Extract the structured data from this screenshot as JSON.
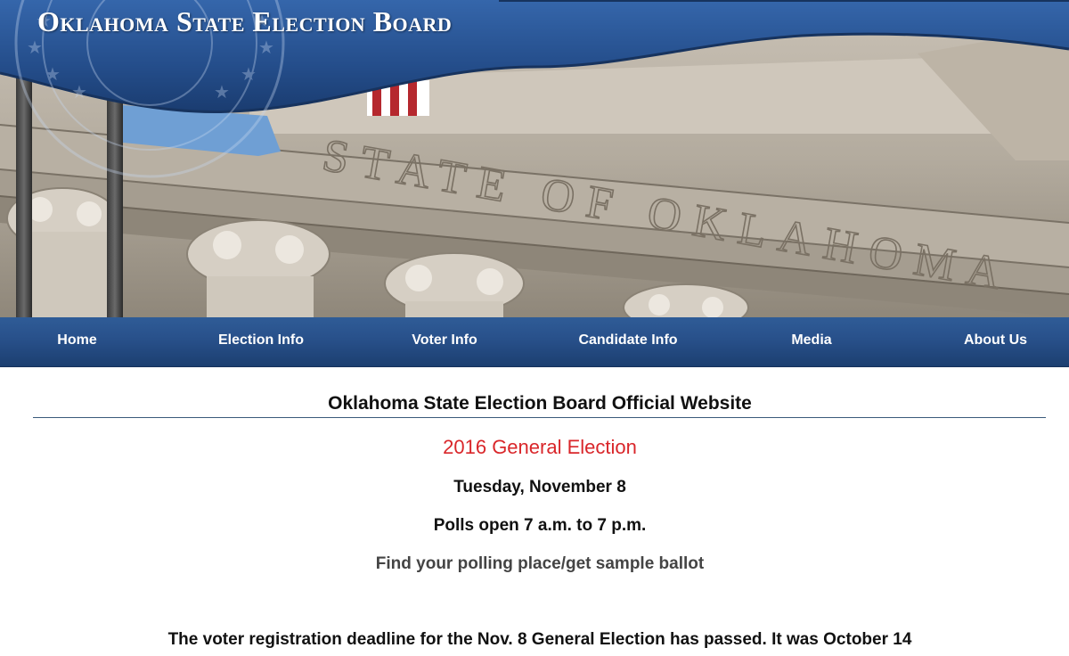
{
  "header": {
    "site_title": "Oklahoma State Election Board",
    "facade_inscription": "STATE OF OKLAHOMA"
  },
  "nav": {
    "items": [
      {
        "label": "Home"
      },
      {
        "label": "Election Info"
      },
      {
        "label": "Voter Info"
      },
      {
        "label": "Candidate Info"
      },
      {
        "label": "Media"
      },
      {
        "label": "About Us"
      }
    ]
  },
  "main": {
    "title": "Oklahoma State Election Board Official Website",
    "election_name": "2016 General Election",
    "election_date": "Tuesday, November 8",
    "polls_hours": "Polls open 7 a.m. to 7 p.m.",
    "polling_place_link": "Find your polling place/get sample ballot",
    "registration_notice": "The voter registration deadline for the Nov. 8 General Election has passed. It was October 14"
  },
  "colors": {
    "nav_background": "#28508a",
    "header_banner": "#2d5a9c",
    "election_name": "#d9262a",
    "link_text": "#444444"
  },
  "icons": [
    "state-seal-icon"
  ]
}
